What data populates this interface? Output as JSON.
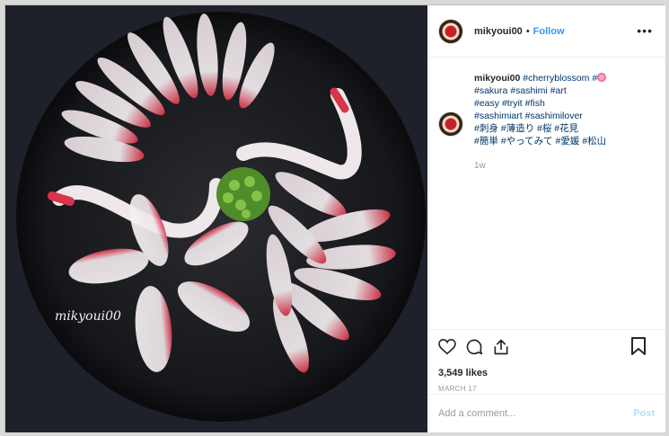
{
  "photo": {
    "watermark": "mikyoui00",
    "alt": "sashimi arranged as crane and cherry blossom on black plate"
  },
  "header": {
    "username": "mikyoui00",
    "separator": "•",
    "follow_label": "Follow",
    "more_label": "•••"
  },
  "caption": {
    "username": "mikyoui00",
    "lines": [
      [
        "#cherryblossom",
        "#"
      ],
      [
        "#sakura",
        "#sashimi",
        "#art"
      ],
      [
        "#easy",
        "#tryit",
        "#fish"
      ],
      [
        "#sashimiart",
        "#sashimilover"
      ],
      [
        "#刺身",
        "#薄造り",
        "#桜",
        "#花見"
      ],
      [
        "#簡単",
        "#やってみて",
        "#愛媛",
        "#松山"
      ]
    ],
    "time": "1w"
  },
  "actions": {
    "likes": "3,549 likes",
    "date": "MARCH 17"
  },
  "comment": {
    "placeholder": "Add a comment...",
    "post_label": "Post"
  },
  "colors": {
    "link": "#003569",
    "follow": "#3897f0",
    "post_disabled": "#b2dffc"
  }
}
